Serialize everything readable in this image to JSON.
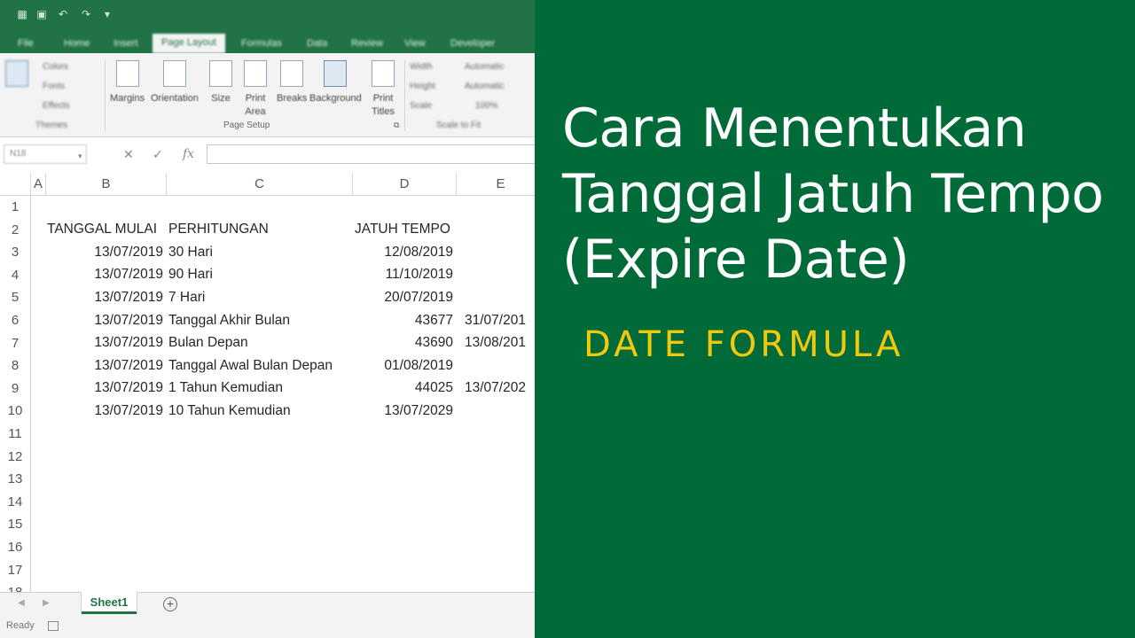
{
  "ribbon": {
    "tabs": [
      "File",
      "Home",
      "Insert",
      "Page Layout",
      "Formulas",
      "Data",
      "Review",
      "View",
      "Developer"
    ],
    "active_tab": "Page Layout",
    "themes": {
      "items": [
        "Colors",
        "Fonts",
        "Effects"
      ],
      "group_label": "Themes"
    },
    "page_setup": {
      "margins": "Margins",
      "orientation": "Orientation",
      "size": "Size",
      "print_area": "Print Area",
      "breaks": "Breaks",
      "background": "Background",
      "print_titles": "Print Titles",
      "group_label": "Page Setup"
    },
    "scale_to_fit": {
      "width": "Width",
      "width_value": "Automatic",
      "height": "Height",
      "height_value": "Automatic",
      "scale": "Scale",
      "scale_value": "100%",
      "group_label": "Scale to Fit"
    }
  },
  "formula_bar": {
    "name_box": "N18",
    "cancel_icon": "✕",
    "enter_icon": "✓",
    "fx_label": "fx",
    "value": ""
  },
  "grid": {
    "columns": [
      "A",
      "B",
      "C",
      "D",
      "E"
    ],
    "row_numbers": [
      "1",
      "2",
      "3",
      "4",
      "5",
      "6",
      "7",
      "8",
      "9",
      "10",
      "11",
      "12",
      "13",
      "14",
      "15",
      "16",
      "17",
      "18"
    ],
    "headers": {
      "b": "TANGGAL MULAI",
      "c": "PERHITUNGAN",
      "d": "JATUH TEMPO"
    },
    "rows": [
      {
        "b": "13/07/2019",
        "c": "30 Hari",
        "d": "12/08/2019",
        "e": ""
      },
      {
        "b": "13/07/2019",
        "c": "90 Hari",
        "d": "11/10/2019",
        "e": ""
      },
      {
        "b": "13/07/2019",
        "c": "7 Hari",
        "d": "20/07/2019",
        "e": ""
      },
      {
        "b": "13/07/2019",
        "c": "Tanggal Akhir Bulan",
        "d": "43677",
        "e": "31/07/201"
      },
      {
        "b": "13/07/2019",
        "c": "Bulan Depan",
        "d": "43690",
        "e": "13/08/201"
      },
      {
        "b": "13/07/2019",
        "c": "Tanggal Awal Bulan Depan",
        "d": "01/08/2019",
        "e": ""
      },
      {
        "b": "13/07/2019",
        "c": "1 Tahun Kemudian",
        "d": "44025",
        "e": "13/07/202"
      },
      {
        "b": "13/07/2019",
        "c": "10 Tahun Kemudian",
        "d": "13/07/2029",
        "e": ""
      }
    ]
  },
  "sheets": {
    "active": "Sheet1",
    "add_symbol": "+"
  },
  "status": {
    "text": "Ready"
  },
  "panel": {
    "title_line1": "Cara Menentukan",
    "title_line2": "Tanggal Jatuh Tempo",
    "title_line3": "(Expire Date)",
    "subtitle": "DATE FORMULA",
    "background_color": "#016a39",
    "subtitle_color": "#f2c80f"
  },
  "colors": {
    "excel_green": "#217346"
  }
}
